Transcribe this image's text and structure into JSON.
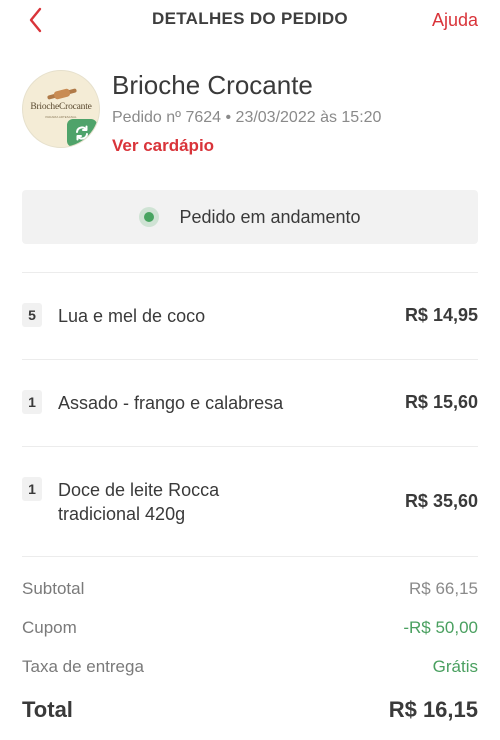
{
  "header": {
    "title": "DETALHES DO PEDIDO",
    "help_label": "Ajuda",
    "back_icon": "chevron-left-icon"
  },
  "store": {
    "name": "Brioche Crocante",
    "logo_text": "BriocheCrocante",
    "logo_subtext": "PADARIA ARTESANAL",
    "order_meta": "Pedido nº 7624 • 23/03/2022 às 15:20",
    "menu_link": "Ver cardápio"
  },
  "status": {
    "text": "Pedido em andamento",
    "color": "#47a460"
  },
  "items": [
    {
      "qty": "5",
      "name": "Lua e mel de coco",
      "price": "R$ 14,95"
    },
    {
      "qty": "1",
      "name": "Assado - frango e calabresa",
      "price": "R$ 15,60"
    },
    {
      "qty": "1",
      "name_line1": "Doce de leite Rocca",
      "name_line2": "tradicional 420g",
      "price": "R$ 35,60"
    }
  ],
  "summary": {
    "subtotal_label": "Subtotal",
    "subtotal_value": "R$ 66,15",
    "coupon_label": "Cupom",
    "coupon_value": "-R$ 50,00",
    "delivery_label": "Taxa de entrega",
    "delivery_value": "Grátis",
    "total_label": "Total",
    "total_value": "R$ 16,15"
  },
  "colors": {
    "accent": "#d9343a",
    "success": "#4aa060"
  }
}
